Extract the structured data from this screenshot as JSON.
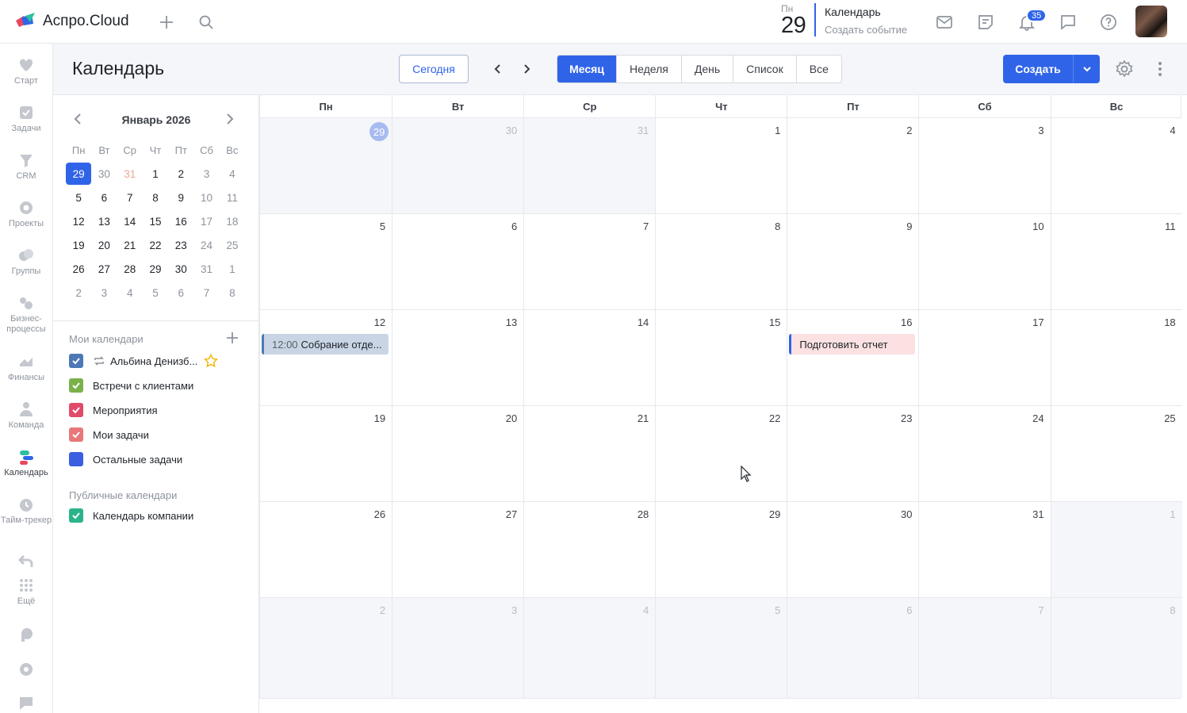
{
  "app": {
    "name": "Аспро.Cloud"
  },
  "topbar": {
    "date_dow": "Пн",
    "date_day": "29",
    "title": "Календарь",
    "subtitle": "Создать событие",
    "notifications_count": "35"
  },
  "sidebar": {
    "items": [
      {
        "label": "Старт",
        "icon": "heart-icon"
      },
      {
        "label": "Задачи",
        "icon": "tasks-icon"
      },
      {
        "label": "CRM",
        "icon": "crm-icon"
      },
      {
        "label": "Проекты",
        "icon": "projects-icon"
      },
      {
        "label": "Группы",
        "icon": "groups-icon"
      },
      {
        "label": "Бизнес-процессы",
        "icon": "business-process-icon"
      },
      {
        "label": "Финансы",
        "icon": "finance-icon"
      },
      {
        "label": "Команда",
        "icon": "team-icon"
      },
      {
        "label": "Календарь",
        "icon": "calendar-icon",
        "active": true
      },
      {
        "label": "Тайм-трекер",
        "icon": "timer-icon"
      },
      {
        "label": "Ещё",
        "icon": "more-grid-icon"
      }
    ]
  },
  "header": {
    "title": "Календарь",
    "today": "Сегодня",
    "views": [
      "Месяц",
      "Неделя",
      "День",
      "Список",
      "Все"
    ],
    "active_view": "Месяц",
    "create": "Создать"
  },
  "mini_calendar": {
    "title": "Январь 2026",
    "weekdays": [
      "Пн",
      "Вт",
      "Ср",
      "Чт",
      "Пт",
      "Сб",
      "Вс"
    ],
    "weeks": [
      [
        "29",
        "30",
        "31",
        "1",
        "2",
        "3",
        "4"
      ],
      [
        "5",
        "6",
        "7",
        "8",
        "9",
        "10",
        "11"
      ],
      [
        "12",
        "13",
        "14",
        "15",
        "16",
        "17",
        "18"
      ],
      [
        "19",
        "20",
        "21",
        "22",
        "23",
        "24",
        "25"
      ],
      [
        "26",
        "27",
        "28",
        "29",
        "30",
        "31",
        "1"
      ],
      [
        "2",
        "3",
        "4",
        "5",
        "6",
        "7",
        "8"
      ]
    ]
  },
  "my_calendars": {
    "title": "Мои календари",
    "items": [
      {
        "label": "Альбина Денизб...",
        "color": "#4c78b5",
        "checked": true,
        "repeat": true,
        "star": true
      },
      {
        "label": "Встречи с клиентами",
        "color": "#7cb14a",
        "checked": true
      },
      {
        "label": "Мероприятия",
        "color": "#e24a6a",
        "checked": true
      },
      {
        "label": "Мои задачи",
        "color": "#e8787a",
        "checked": true
      },
      {
        "label": "Остальные задачи",
        "color": "#3a5fe0",
        "checked": false
      }
    ]
  },
  "public_calendars": {
    "title": "Публичные календари",
    "items": [
      {
        "label": "Календарь компании",
        "color": "#2bb38a",
        "checked": true
      }
    ]
  },
  "month_grid": {
    "weekdays": [
      "Пн",
      "Вт",
      "Ср",
      "Чт",
      "Пт",
      "Сб",
      "Вс"
    ],
    "weeks": [
      [
        "29",
        "30",
        "31",
        "1",
        "2",
        "3",
        "4"
      ],
      [
        "5",
        "6",
        "7",
        "8",
        "9",
        "10",
        "11"
      ],
      [
        "12",
        "13",
        "14",
        "15",
        "16",
        "17",
        "18"
      ],
      [
        "19",
        "20",
        "21",
        "22",
        "23",
        "24",
        "25"
      ],
      [
        "26",
        "27",
        "28",
        "29",
        "30",
        "31",
        "1"
      ],
      [
        "2",
        "3",
        "4",
        "5",
        "6",
        "7",
        "8"
      ]
    ],
    "events": [
      {
        "time": "12:00",
        "title": "Собрание отде..."
      },
      {
        "time": "",
        "title": "Подготовить отчет"
      }
    ]
  }
}
